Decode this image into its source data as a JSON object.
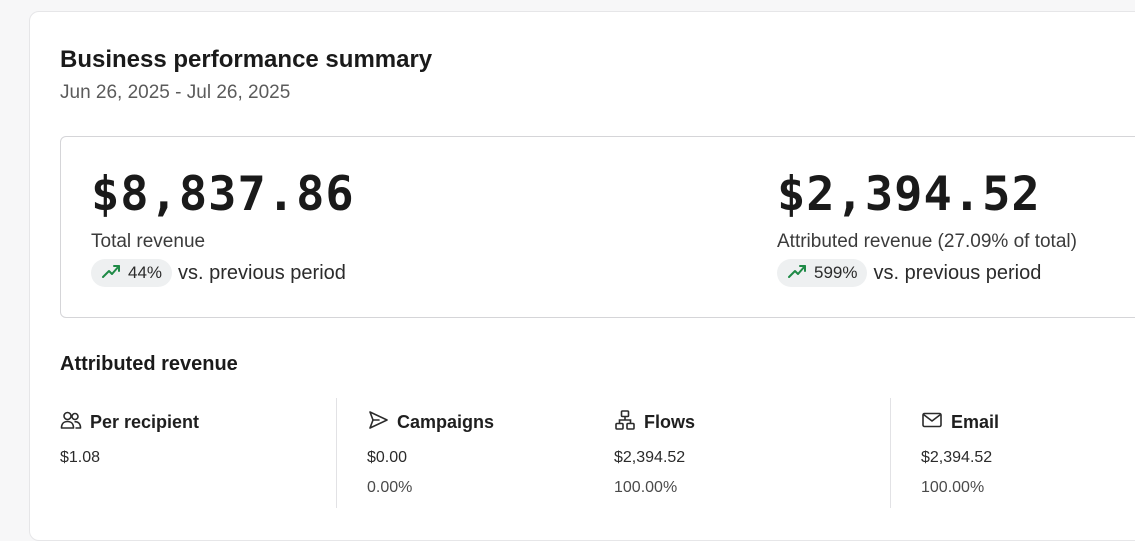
{
  "summary": {
    "title": "Business performance summary",
    "date_range": "Jun 26, 2025 - Jul 26, 2025"
  },
  "metrics": {
    "total": {
      "value": "$8,837.86",
      "label": "Total revenue",
      "change": "44%",
      "comparison": "vs. previous period"
    },
    "attributed": {
      "value": "$2,394.52",
      "label": "Attributed revenue (27.09% of total)",
      "change": "599%",
      "comparison": "vs. previous period"
    }
  },
  "attributed_revenue": {
    "title": "Attributed revenue",
    "items": [
      {
        "label": "Per recipient",
        "icon": "users-icon",
        "value": "$1.08",
        "percent": ""
      },
      {
        "label": "Campaigns",
        "icon": "send-icon",
        "value": "$0.00",
        "percent": "0.00%"
      },
      {
        "label": "Flows",
        "icon": "flow-icon",
        "value": "$2,394.52",
        "percent": "100.00%"
      },
      {
        "label": "Email",
        "icon": "mail-icon",
        "value": "$2,394.52",
        "percent": "100.00%"
      }
    ]
  },
  "colors": {
    "trend_up": "#1e8a46",
    "pill_bg": "#eef0f1"
  }
}
